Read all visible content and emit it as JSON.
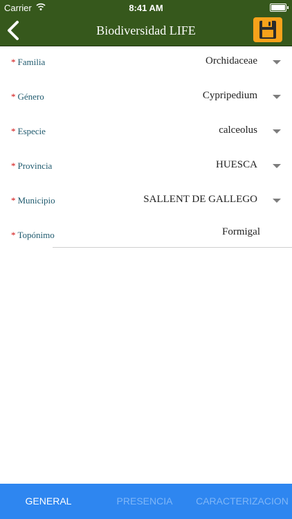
{
  "status_bar": {
    "carrier": "Carrier",
    "time": "8:41 AM"
  },
  "nav": {
    "title": "Biodiversidad LIFE",
    "back_icon": "chevron-left-icon",
    "save_icon": "floppy-disk-icon"
  },
  "colors": {
    "header": "#36581c",
    "save_button": "#f7a21b",
    "required": "#d01010",
    "label": "#1f5a6e",
    "tab_bar": "#2e86f0"
  },
  "form": {
    "required_marker": "*",
    "fields": [
      {
        "label": "Familia",
        "value": "Orchidaceae"
      },
      {
        "label": "Género",
        "value": "Cypripedium"
      },
      {
        "label": "Especie",
        "value": "calceolus"
      },
      {
        "label": "Provincia",
        "value": "HUESCA"
      },
      {
        "label": "Municipio",
        "value": "SALLENT DE GALLEGO"
      },
      {
        "label": "Topónimo",
        "value": "Formigal"
      }
    ]
  },
  "tabs": [
    {
      "label": "GENERAL",
      "active": true
    },
    {
      "label": "PRESENCIA",
      "active": false
    },
    {
      "label": "CARACTERIZACION",
      "active": false
    }
  ]
}
